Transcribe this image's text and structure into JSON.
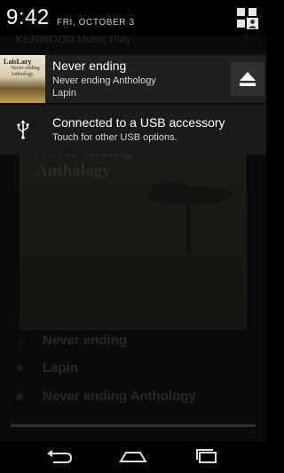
{
  "status": {
    "time": "9:42",
    "date": "FRI, OCTOBER 3"
  },
  "background_app": {
    "toolbar_title": "KENWOOD Music Play",
    "album_title_line1": "Never ending",
    "album_title_line2": "Anthology",
    "tracks": [
      {
        "icon": "music-note-icon",
        "label": "Never ending"
      },
      {
        "icon": "person-icon",
        "label": "Lapin"
      },
      {
        "icon": "album-icon",
        "label": "Never ending Anthology"
      }
    ]
  },
  "notifications": {
    "media": {
      "thumb_text": [
        "LaisLary",
        "Never ending",
        "Anthology"
      ],
      "title": "Never ending",
      "album": "Never ending Anthology",
      "artist": "Lapin",
      "action_icon": "eject-icon"
    },
    "usb": {
      "icon": "usb-icon",
      "title": "Connected to a USB accessory",
      "subtitle": "Touch for other USB options."
    }
  },
  "navbar": {
    "icons": [
      "back-icon",
      "home-icon",
      "recents-icon"
    ]
  },
  "colors": {
    "notification_bg": "#1f1f1f",
    "eject_button_bg": "#303030",
    "text_primary": "#ffffff",
    "text_secondary": "#d6d6d6"
  }
}
